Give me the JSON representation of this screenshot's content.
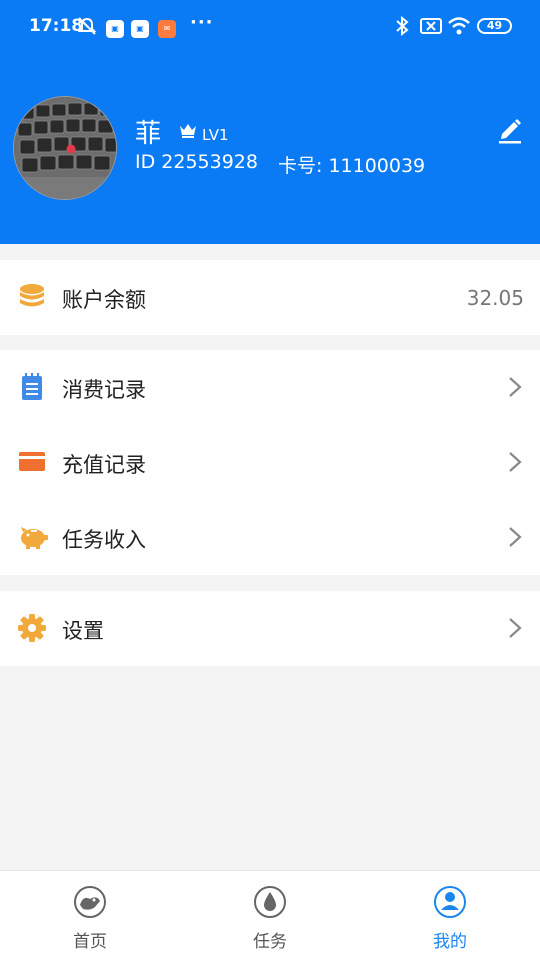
{
  "status_bar": {
    "time": "17:18",
    "battery": "49",
    "more": "···"
  },
  "profile": {
    "name": "菲",
    "level": "LV1",
    "id_text": "ID 22553928",
    "card_text": "卡号: 11100039"
  },
  "balance": {
    "label": "账户余额",
    "value": "32.05",
    "icon": "coins-icon",
    "color": "#f2a93b"
  },
  "menu": [
    {
      "label": "消费记录",
      "icon": "notepad-icon",
      "color": "#3f8ae6"
    },
    {
      "label": "充值记录",
      "icon": "card-icon",
      "color": "#f07030"
    },
    {
      "label": "任务收入",
      "icon": "piggy-bank-icon",
      "color": "#f2a93b"
    }
  ],
  "settings": {
    "label": "设置",
    "icon": "gear-icon",
    "color": "#f2a93b"
  },
  "bottom_nav": [
    {
      "label": "首页",
      "icon": "home-icon",
      "active": false
    },
    {
      "label": "任务",
      "icon": "task-drop-icon",
      "active": false
    },
    {
      "label": "我的",
      "icon": "user-icon",
      "active": true
    }
  ],
  "colors": {
    "header": "#0a7bf5",
    "accent": "#1a86ee"
  }
}
